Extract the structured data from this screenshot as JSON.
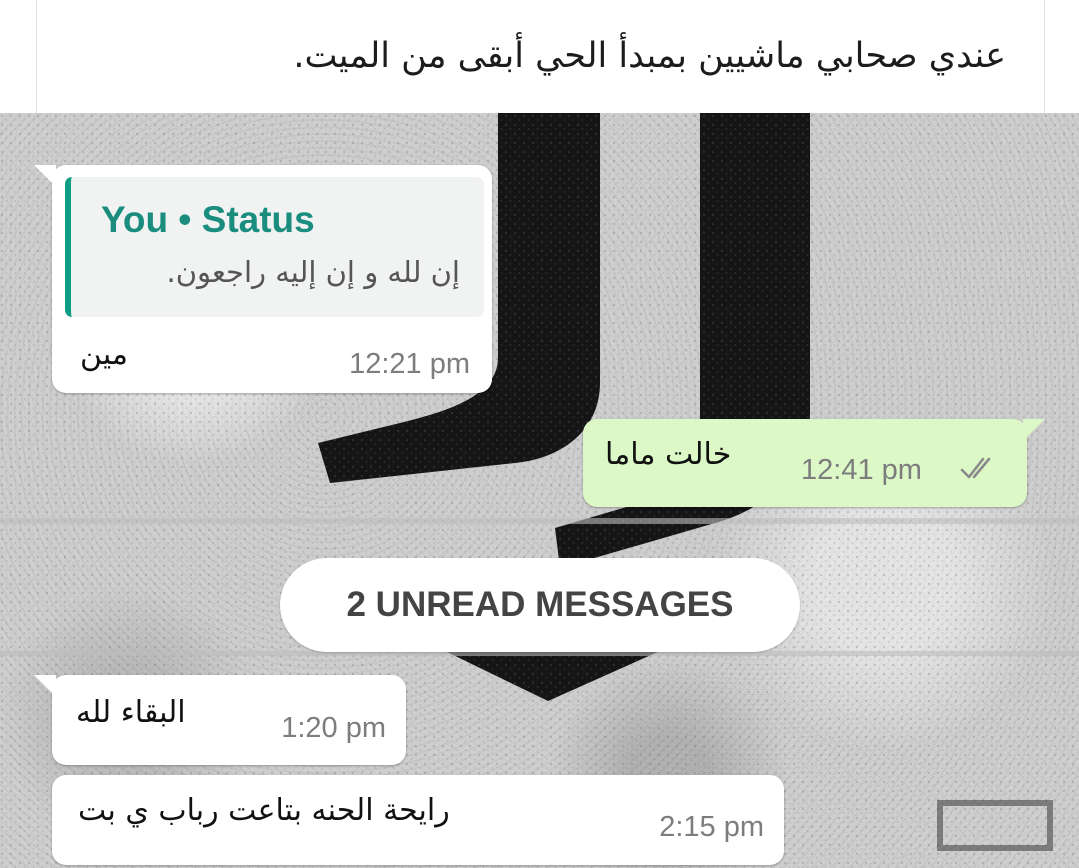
{
  "post": {
    "caption": "عندي صحابي ماشيين بمبدأ الحي أبقى من الميت."
  },
  "chat": {
    "messages": [
      {
        "direction": "incoming",
        "quoted": {
          "author": "You • Status",
          "text": "إن لله و إن إليه راجعون."
        },
        "text": "مين",
        "time": "12:21 pm"
      },
      {
        "direction": "outgoing",
        "text": "خالت ماما",
        "time": "12:41 pm",
        "status_icon": "double-check-icon"
      },
      {
        "direction": "incoming",
        "text": "البقاء لله",
        "time": "1:20 pm"
      },
      {
        "direction": "incoming",
        "text": "رايحة الحنه بتاعت رباب ي بت",
        "time": "2:15 pm"
      }
    ],
    "unread_divider": "2 UNREAD MESSAGES"
  },
  "colors": {
    "incoming_bubble": "#ffffff",
    "outgoing_bubble": "#dcf8c6",
    "quote_accent": "#0f9d84",
    "quote_author": "#1a8d7e"
  }
}
